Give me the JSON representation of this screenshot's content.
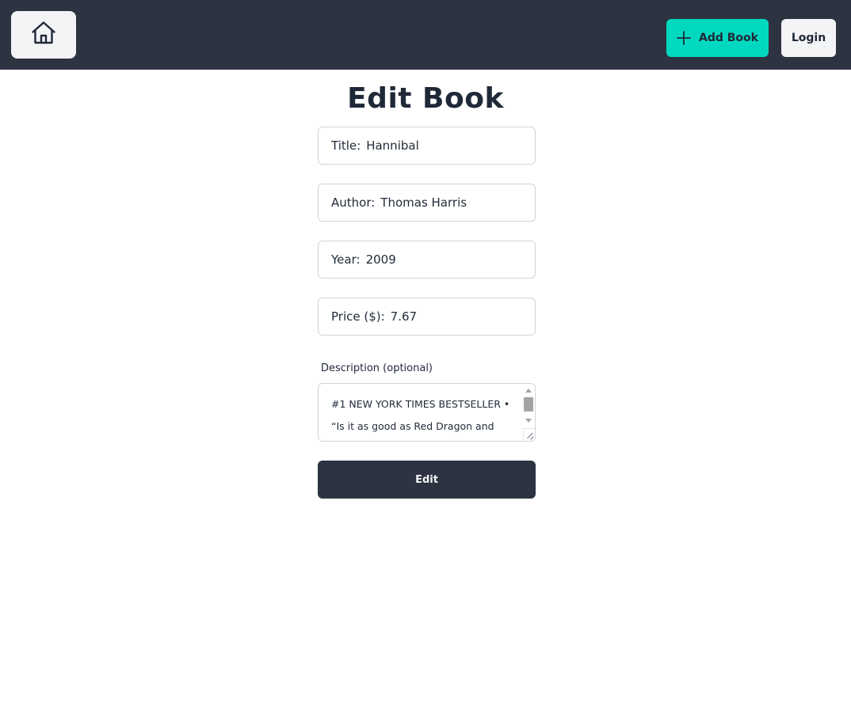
{
  "header": {
    "home_icon": "home-icon",
    "add_book": {
      "icon": "plus-icon",
      "label": "Add Book"
    },
    "login_label": "Login",
    "colors": {
      "bar": "#2d3340",
      "accent": "#00d8c0"
    }
  },
  "page": {
    "title": "Edit Book"
  },
  "form": {
    "fields": [
      {
        "label": "Title:",
        "value": "Hannibal"
      },
      {
        "label": "Author:",
        "value": "Thomas Harris"
      },
      {
        "label": "Year:",
        "value": "2009"
      },
      {
        "label": "Price ($):",
        "value": "7.67"
      }
    ],
    "description": {
      "label": "Description (optional)",
      "lines": [
        "#1 NEW YORK TIMES BESTSELLER •",
        "“Is it as good as Red Dragon and"
      ]
    },
    "submit_label": "Edit"
  }
}
